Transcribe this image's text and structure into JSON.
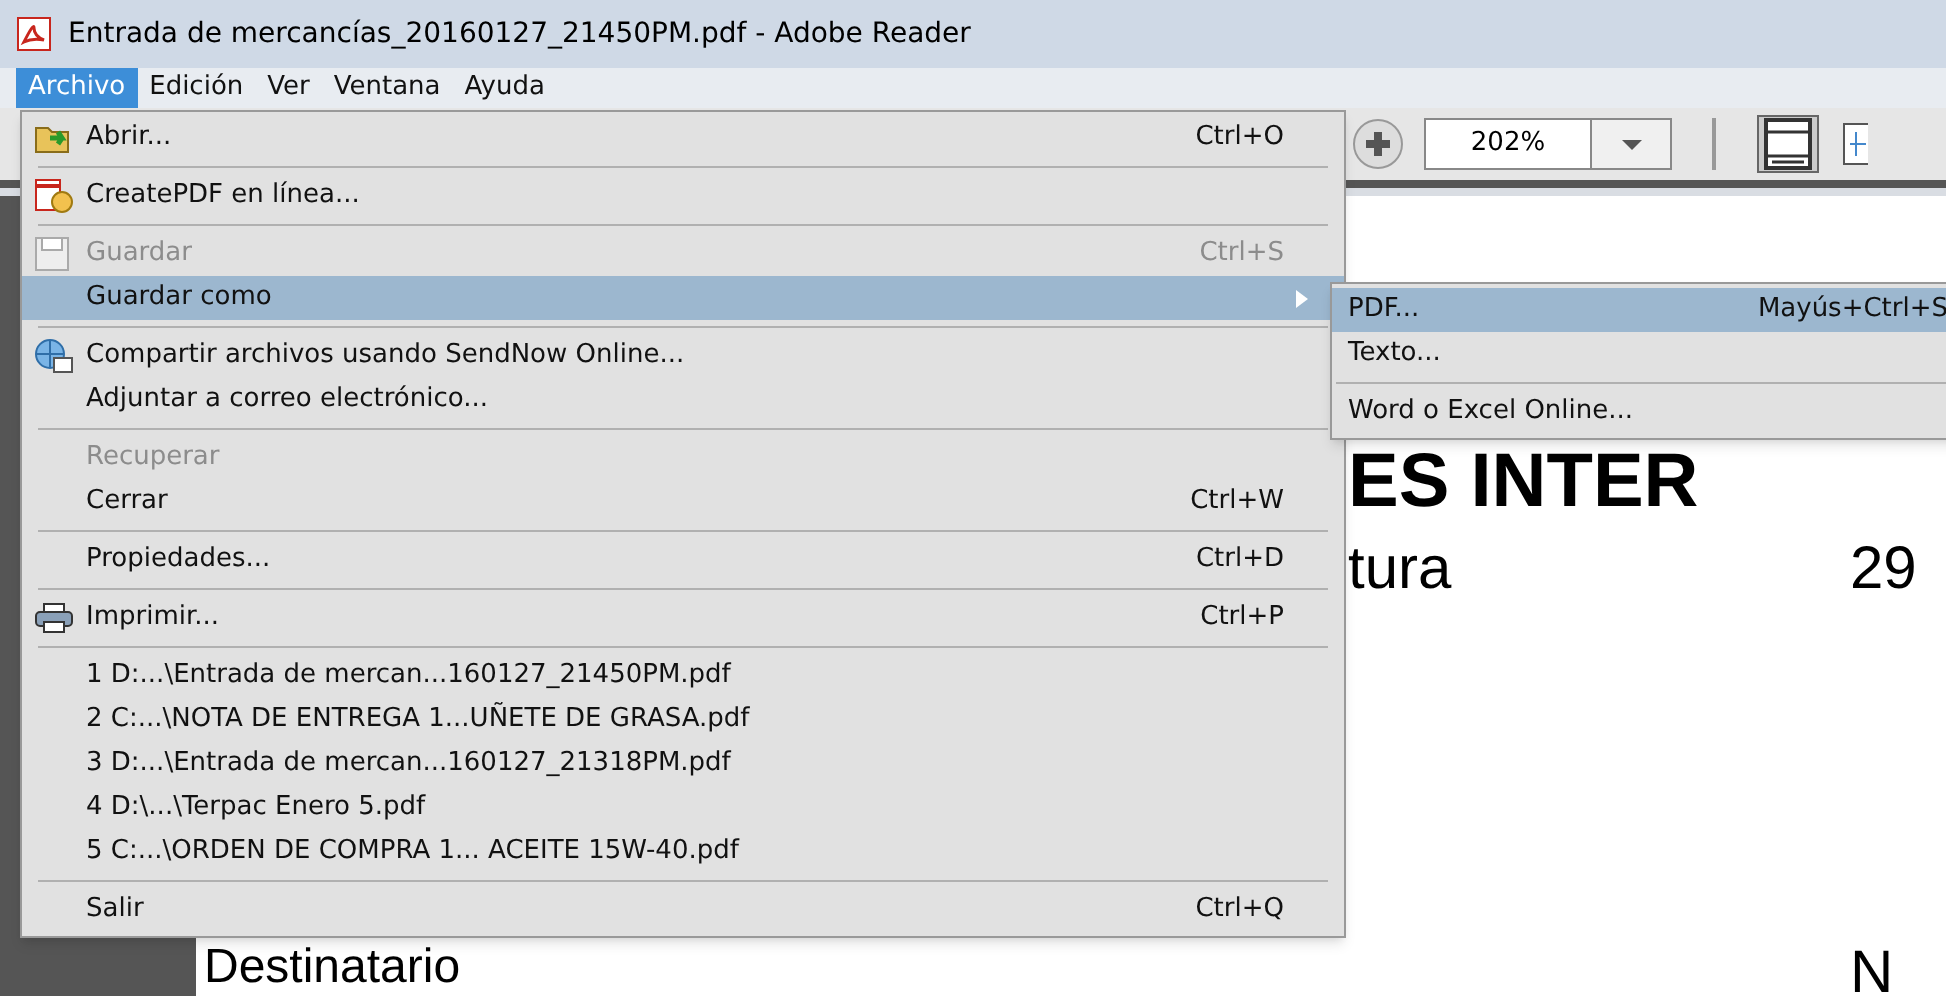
{
  "window": {
    "title": "Entrada de mercancías_20160127_21450PM.pdf - Adobe Reader"
  },
  "menubar": [
    {
      "label": "Archivo",
      "selected": true
    },
    {
      "label": "Edición",
      "selected": false
    },
    {
      "label": "Ver",
      "selected": false
    },
    {
      "label": "Ventana",
      "selected": false
    },
    {
      "label": "Ayuda",
      "selected": false
    }
  ],
  "toolbar": {
    "zoom": "202%"
  },
  "menu": [
    {
      "kind": "item",
      "label": "Abrir...",
      "shortcut": "Ctrl+O",
      "disabled": false,
      "selected": false
    },
    {
      "kind": "separator"
    },
    {
      "kind": "item",
      "label": "CreatePDF en línea...",
      "disabled": false,
      "selected": false
    },
    {
      "kind": "separator"
    },
    {
      "kind": "item",
      "label": "Guardar",
      "shortcut": "Ctrl+S",
      "disabled": true,
      "selected": false
    },
    {
      "kind": "item",
      "label": "Guardar como",
      "disabled": false,
      "selected": true,
      "submenu": true
    },
    {
      "kind": "separator"
    },
    {
      "kind": "item",
      "label": "Compartir archivos usando SendNow Online...",
      "disabled": false,
      "selected": false
    },
    {
      "kind": "item",
      "label": "Adjuntar a correo electrónico...",
      "disabled": false,
      "selected": false
    },
    {
      "kind": "separator"
    },
    {
      "kind": "item",
      "label": "Recuperar",
      "disabled": true,
      "selected": false
    },
    {
      "kind": "item",
      "label": "Cerrar",
      "shortcut": "Ctrl+W",
      "disabled": false,
      "selected": false
    },
    {
      "kind": "separator"
    },
    {
      "kind": "item",
      "label": "Propiedades...",
      "shortcut": "Ctrl+D",
      "disabled": false,
      "selected": false
    },
    {
      "kind": "separator"
    },
    {
      "kind": "item",
      "label": "Imprimir...",
      "shortcut": "Ctrl+P",
      "disabled": false,
      "selected": false
    },
    {
      "kind": "separator"
    },
    {
      "kind": "item",
      "label": "1 D:...\\Entrada de mercan...160127_21450PM.pdf",
      "disabled": false,
      "selected": false
    },
    {
      "kind": "item",
      "label": "2 C:...\\NOTA DE ENTREGA 1...UÑETE DE GRASA.pdf",
      "disabled": false,
      "selected": false
    },
    {
      "kind": "item",
      "label": "3 D:...\\Entrada de mercan...160127_21318PM.pdf",
      "disabled": false,
      "selected": false
    },
    {
      "kind": "item",
      "label": "4 D:\\...\\Terpac Enero 5.pdf",
      "disabled": false,
      "selected": false
    },
    {
      "kind": "item",
      "label": "5 C:...\\ORDEN DE COMPRA 1... ACEITE 15W-40.pdf",
      "disabled": false,
      "selected": false
    },
    {
      "kind": "separator"
    },
    {
      "kind": "item",
      "label": "Salir",
      "shortcut": "Ctrl+Q",
      "disabled": false,
      "selected": false
    }
  ],
  "submenu": [
    {
      "kind": "item",
      "label": "PDF...",
      "shortcut": "Mayús+Ctrl+S",
      "selected": true
    },
    {
      "kind": "item",
      "label": "Texto...",
      "selected": false
    },
    {
      "kind": "separator"
    },
    {
      "kind": "item",
      "label": "Word o Excel Online...",
      "selected": false
    }
  ],
  "document": {
    "heading": "ES INTER",
    "label_1": "tura",
    "value_1": "29",
    "label_2": "Destinatario",
    "value_2": "N"
  }
}
